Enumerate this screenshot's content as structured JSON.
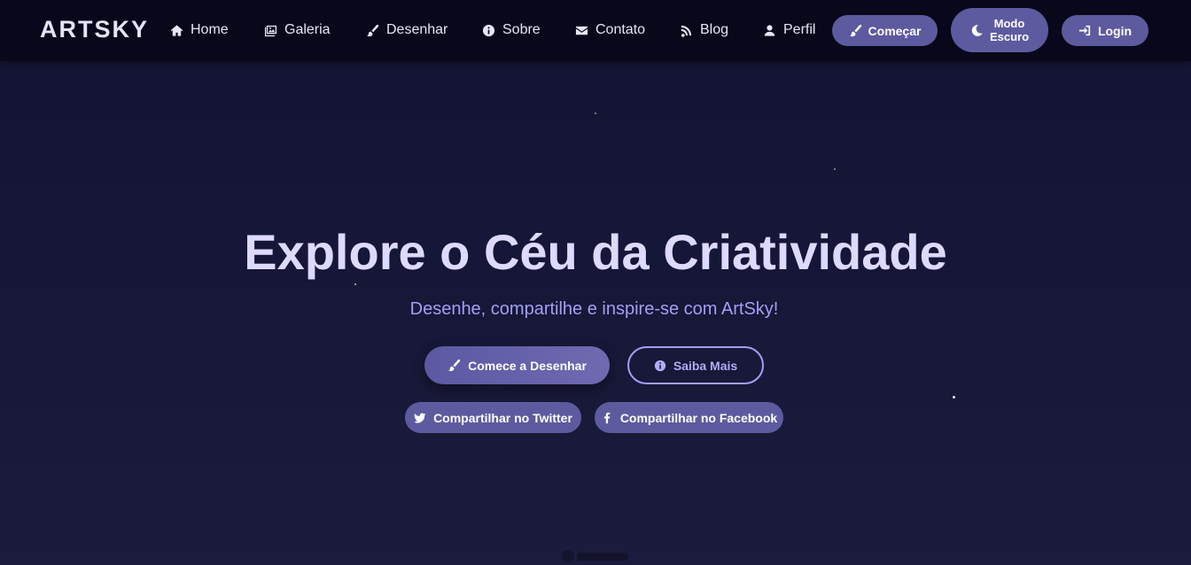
{
  "brand": {
    "logo": "ARTSKY"
  },
  "nav": {
    "items": [
      {
        "label": "Home",
        "icon": "home-icon"
      },
      {
        "label": "Galeria",
        "icon": "gallery-icon"
      },
      {
        "label": "Desenhar",
        "icon": "brush-icon"
      },
      {
        "label": "Sobre",
        "icon": "info-icon"
      },
      {
        "label": "Contato",
        "icon": "envelope-icon"
      },
      {
        "label": "Blog",
        "icon": "blog-icon"
      },
      {
        "label": "Perfil",
        "icon": "user-icon"
      }
    ],
    "start_label": "Começar",
    "dark_mode_line1": "Modo",
    "dark_mode_line2": "Escuro",
    "login_label": "Login"
  },
  "hero": {
    "title": "Explore o Céu da Criatividade",
    "subtitle": "Desenhe, compartilhe e inspire-se com ArtSky!",
    "primary_cta": "Comece a Desenhar",
    "secondary_cta": "Saiba Mais",
    "share_twitter": "Compartilhar no Twitter",
    "share_facebook": "Compartilhar no Facebook"
  },
  "colors": {
    "nav_background": "#08081a",
    "page_background": "#151538",
    "accent": "#5e5a9f",
    "title_text": "#ddd9ff",
    "subtitle_text": "#a39ef5"
  }
}
